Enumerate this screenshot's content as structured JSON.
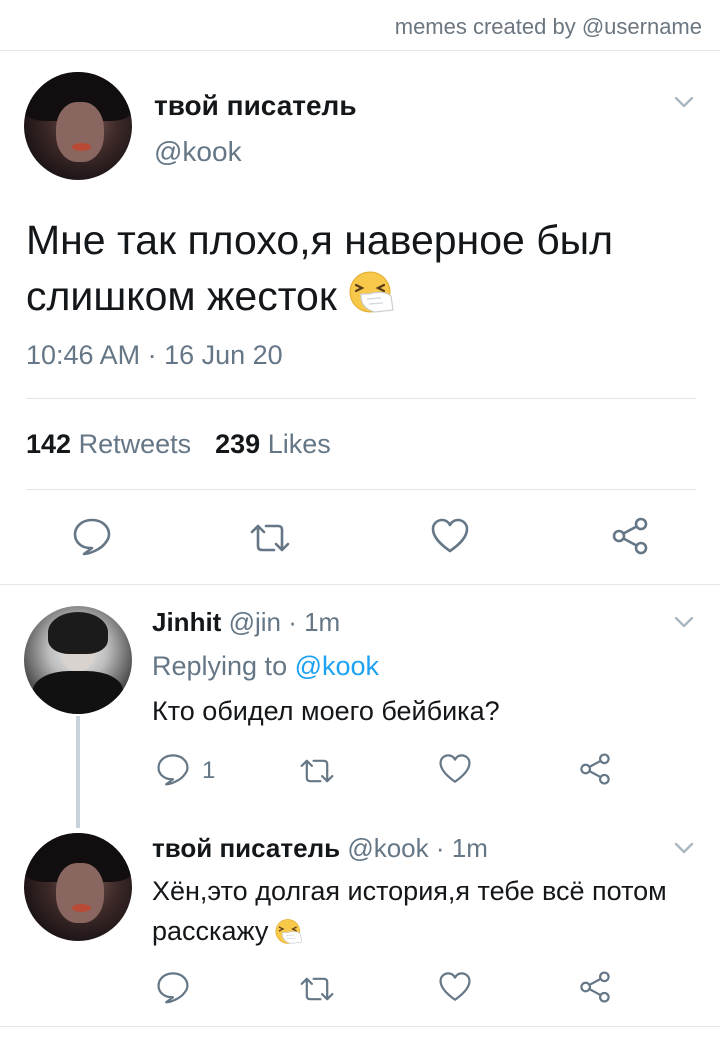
{
  "watermark": "memes created by @username",
  "main_tweet": {
    "name": "твой писатель",
    "handle": "@kook",
    "text": "Мне так плохо,я наверное был слишком жесток",
    "emoji": "sneezing-face",
    "timestamp": "10:46 AM · 16 Jun 20",
    "retweets_count": "142",
    "retweets_label": "Retweets",
    "likes_count": "239",
    "likes_label": "Likes"
  },
  "replies": [
    {
      "name": "Jinhit",
      "handle": "@jin",
      "time": "· 1m",
      "replying_label": "Replying to",
      "replying_to": "@kook",
      "text": "Кто обидел моего бейбика?",
      "reply_count": "1"
    },
    {
      "name": "твой писатель",
      "handle": "@kook",
      "time": "· 1m",
      "text": "Хён,это долгая история,я тебе всё потом расскажу",
      "emoji": "sneezing-face"
    }
  ],
  "colors": {
    "accent": "#1da1f2",
    "text": "#14171a",
    "muted": "#657786",
    "border": "#e1e8ed"
  },
  "icons": [
    "chevron-down-icon",
    "reply-icon",
    "retweet-icon",
    "like-icon",
    "share-icon",
    "sneezing-face-emoji"
  ]
}
